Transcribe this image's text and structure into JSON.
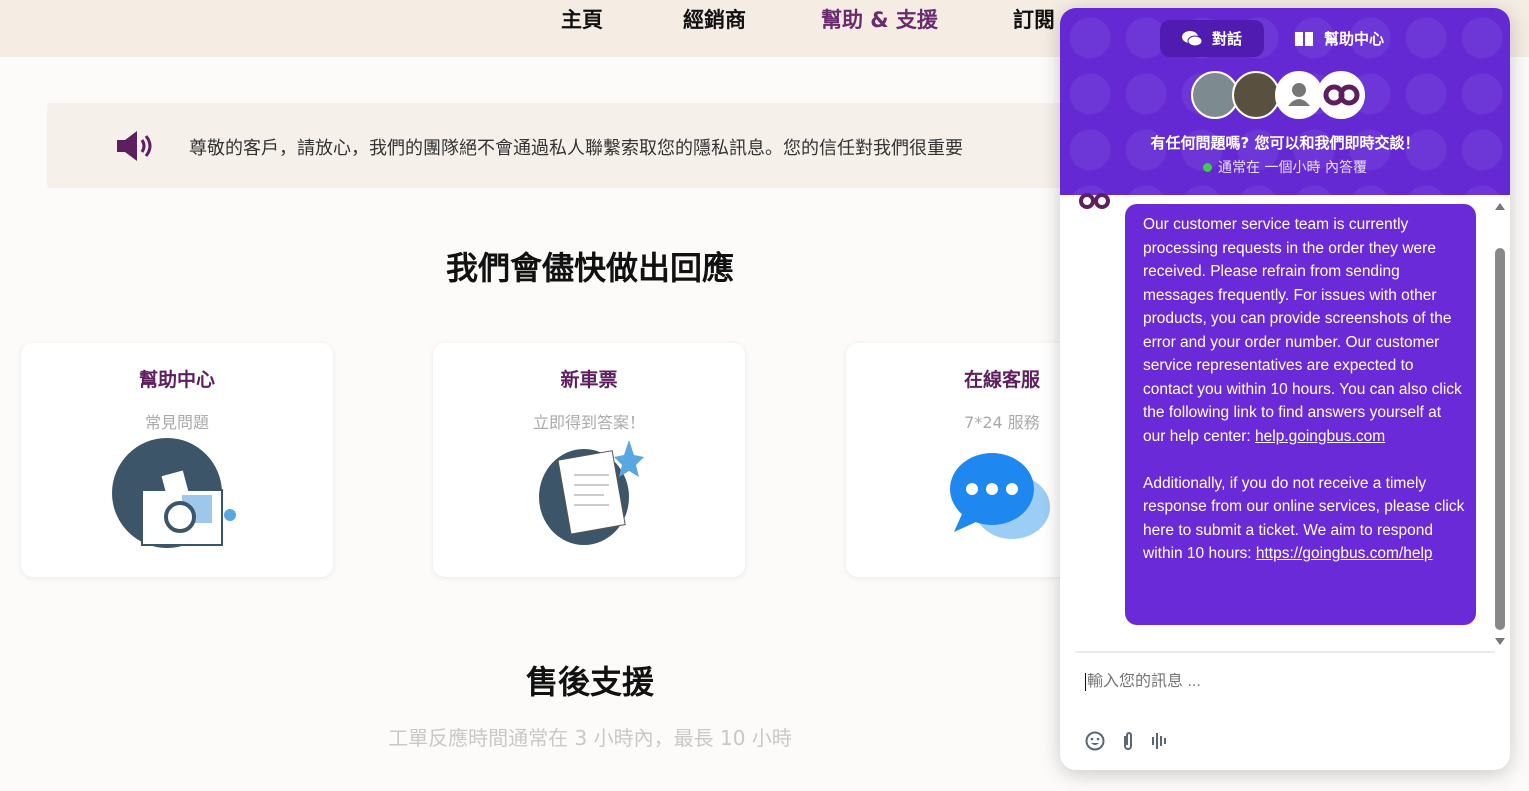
{
  "nav": {
    "items": [
      "主頁",
      "經銷商",
      "幫助 & 支援",
      "訂閱"
    ],
    "active_color": "#6a2a6e"
  },
  "banner": {
    "icon": "speaker-icon",
    "text": "尊敬的客戶，請放心，我們的團隊絕不會通過私人聯繫索取您的隱私訊息。您的信任對我們很重要"
  },
  "section1": {
    "title": "我們會儘快做出回應"
  },
  "cards": [
    {
      "title": "幫助中心",
      "subtitle": "常見問題",
      "icon": "document-search-illustration"
    },
    {
      "title": "新車票",
      "subtitle": "立即得到答案！",
      "icon": "ticket-form-illustration"
    },
    {
      "title": "在線客服",
      "subtitle": "7*24 服務",
      "icon": "chat-bubbles-illustration"
    }
  ],
  "section2": {
    "title": "售後支援",
    "subtitle": "工單反應時間通常在 3 小時內，最長 10 小時"
  },
  "chat": {
    "tabs": [
      {
        "label": "對話",
        "icon": "chat-icon"
      },
      {
        "label": "幫助中心",
        "icon": "book-icon"
      }
    ],
    "title": "有任何問題嗎? 您可以和我們即時交談！",
    "status": "通常在 一個小時 內答覆",
    "status_color": "#3ecf4a",
    "brand_color": "#6429d3",
    "message_p1": "Our customer service team is currently processing requests in the order they were received. Please refrain from sending messages frequently. For issues with other products, you can provide screenshots of the error and your order number. Our customer service representatives are expected to contact you within 10 hours. You can also click the following link to find answers yourself at our help center: ",
    "message_link1": "help.goingbus.com",
    "message_p2": "Additionally, if you do not receive a timely response from our online services, please click here to submit a ticket. We aim to respond within 10 hours: ",
    "message_link2": "https://goingbus.com/help",
    "input_placeholder": "輸入您的訊息 ..."
  }
}
